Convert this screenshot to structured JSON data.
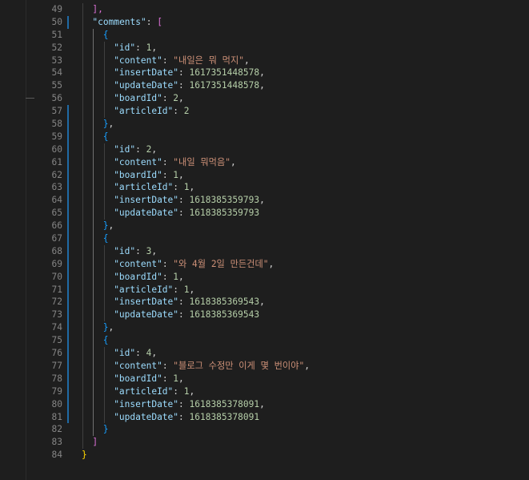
{
  "editor": {
    "lines": [
      {
        "n": "49",
        "d": 1,
        "tokens": [
          {
            "t": "],",
            "c": "b2"
          }
        ]
      },
      {
        "n": "50",
        "d": 1,
        "tokens": [
          {
            "t": "\"comments\"",
            "c": "key"
          },
          {
            "t": ": ",
            "c": "pun"
          },
          {
            "t": "[",
            "c": "b2"
          }
        ]
      },
      {
        "n": "51",
        "d": 2,
        "tokens": [
          {
            "t": "{",
            "c": "b3"
          }
        ]
      },
      {
        "n": "52",
        "d": 3,
        "tokens": [
          {
            "t": "\"id\"",
            "c": "key"
          },
          {
            "t": ": ",
            "c": "pun"
          },
          {
            "t": "1",
            "c": "num"
          },
          {
            "t": ",",
            "c": "pun"
          }
        ]
      },
      {
        "n": "53",
        "d": 3,
        "tokens": [
          {
            "t": "\"content\"",
            "c": "key"
          },
          {
            "t": ": ",
            "c": "pun"
          },
          {
            "t": "\"내일은 뭐 먹지\"",
            "c": "str"
          },
          {
            "t": ",",
            "c": "pun"
          }
        ]
      },
      {
        "n": "54",
        "d": 3,
        "tokens": [
          {
            "t": "\"insertDate\"",
            "c": "key"
          },
          {
            "t": ": ",
            "c": "pun"
          },
          {
            "t": "1617351448578",
            "c": "num"
          },
          {
            "t": ",",
            "c": "pun"
          }
        ]
      },
      {
        "n": "55",
        "d": 3,
        "tokens": [
          {
            "t": "\"updateDate\"",
            "c": "key"
          },
          {
            "t": ": ",
            "c": "pun"
          },
          {
            "t": "1617351448578",
            "c": "num"
          },
          {
            "t": ",",
            "c": "pun"
          }
        ]
      },
      {
        "n": "56",
        "d": 3,
        "tokens": [
          {
            "t": "\"boardId\"",
            "c": "key"
          },
          {
            "t": ": ",
            "c": "pun"
          },
          {
            "t": "2",
            "c": "num"
          },
          {
            "t": ",",
            "c": "pun"
          }
        ]
      },
      {
        "n": "57",
        "d": 3,
        "tokens": [
          {
            "t": "\"articleId\"",
            "c": "key"
          },
          {
            "t": ": ",
            "c": "pun"
          },
          {
            "t": "2",
            "c": "num"
          }
        ]
      },
      {
        "n": "58",
        "d": 2,
        "tokens": [
          {
            "t": "}",
            "c": "b3"
          },
          {
            "t": ",",
            "c": "pun"
          }
        ]
      },
      {
        "n": "59",
        "d": 2,
        "tokens": [
          {
            "t": "{",
            "c": "b3"
          }
        ]
      },
      {
        "n": "60",
        "d": 3,
        "tokens": [
          {
            "t": "\"id\"",
            "c": "key"
          },
          {
            "t": ": ",
            "c": "pun"
          },
          {
            "t": "2",
            "c": "num"
          },
          {
            "t": ",",
            "c": "pun"
          }
        ]
      },
      {
        "n": "61",
        "d": 3,
        "tokens": [
          {
            "t": "\"content\"",
            "c": "key"
          },
          {
            "t": ": ",
            "c": "pun"
          },
          {
            "t": "\"내일 뭐먹음\"",
            "c": "str"
          },
          {
            "t": ",",
            "c": "pun"
          }
        ]
      },
      {
        "n": "62",
        "d": 3,
        "tokens": [
          {
            "t": "\"boardId\"",
            "c": "key"
          },
          {
            "t": ": ",
            "c": "pun"
          },
          {
            "t": "1",
            "c": "num"
          },
          {
            "t": ",",
            "c": "pun"
          }
        ]
      },
      {
        "n": "63",
        "d": 3,
        "tokens": [
          {
            "t": "\"articleId\"",
            "c": "key"
          },
          {
            "t": ": ",
            "c": "pun"
          },
          {
            "t": "1",
            "c": "num"
          },
          {
            "t": ",",
            "c": "pun"
          }
        ]
      },
      {
        "n": "64",
        "d": 3,
        "tokens": [
          {
            "t": "\"insertDate\"",
            "c": "key"
          },
          {
            "t": ": ",
            "c": "pun"
          },
          {
            "t": "1618385359793",
            "c": "num"
          },
          {
            "t": ",",
            "c": "pun"
          }
        ]
      },
      {
        "n": "65",
        "d": 3,
        "tokens": [
          {
            "t": "\"updateDate\"",
            "c": "key"
          },
          {
            "t": ": ",
            "c": "pun"
          },
          {
            "t": "1618385359793",
            "c": "num"
          }
        ]
      },
      {
        "n": "66",
        "d": 2,
        "tokens": [
          {
            "t": "}",
            "c": "b3"
          },
          {
            "t": ",",
            "c": "pun"
          }
        ]
      },
      {
        "n": "67",
        "d": 2,
        "tokens": [
          {
            "t": "{",
            "c": "b3"
          }
        ]
      },
      {
        "n": "68",
        "d": 3,
        "tokens": [
          {
            "t": "\"id\"",
            "c": "key"
          },
          {
            "t": ": ",
            "c": "pun"
          },
          {
            "t": "3",
            "c": "num"
          },
          {
            "t": ",",
            "c": "pun"
          }
        ]
      },
      {
        "n": "69",
        "d": 3,
        "tokens": [
          {
            "t": "\"content\"",
            "c": "key"
          },
          {
            "t": ": ",
            "c": "pun"
          },
          {
            "t": "\"와 4월 2일 만든건데\"",
            "c": "str"
          },
          {
            "t": ",",
            "c": "pun"
          }
        ]
      },
      {
        "n": "70",
        "d": 3,
        "tokens": [
          {
            "t": "\"boardId\"",
            "c": "key"
          },
          {
            "t": ": ",
            "c": "pun"
          },
          {
            "t": "1",
            "c": "num"
          },
          {
            "t": ",",
            "c": "pun"
          }
        ]
      },
      {
        "n": "71",
        "d": 3,
        "tokens": [
          {
            "t": "\"articleId\"",
            "c": "key"
          },
          {
            "t": ": ",
            "c": "pun"
          },
          {
            "t": "1",
            "c": "num"
          },
          {
            "t": ",",
            "c": "pun"
          }
        ]
      },
      {
        "n": "72",
        "d": 3,
        "tokens": [
          {
            "t": "\"insertDate\"",
            "c": "key"
          },
          {
            "t": ": ",
            "c": "pun"
          },
          {
            "t": "1618385369543",
            "c": "num"
          },
          {
            "t": ",",
            "c": "pun"
          }
        ]
      },
      {
        "n": "73",
        "d": 3,
        "tokens": [
          {
            "t": "\"updateDate\"",
            "c": "key"
          },
          {
            "t": ": ",
            "c": "pun"
          },
          {
            "t": "1618385369543",
            "c": "num"
          }
        ]
      },
      {
        "n": "74",
        "d": 2,
        "tokens": [
          {
            "t": "}",
            "c": "b3"
          },
          {
            "t": ",",
            "c": "pun"
          }
        ]
      },
      {
        "n": "75",
        "d": 2,
        "tokens": [
          {
            "t": "{",
            "c": "b3"
          }
        ]
      },
      {
        "n": "76",
        "d": 3,
        "tokens": [
          {
            "t": "\"id\"",
            "c": "key"
          },
          {
            "t": ": ",
            "c": "pun"
          },
          {
            "t": "4",
            "c": "num"
          },
          {
            "t": ",",
            "c": "pun"
          }
        ]
      },
      {
        "n": "77",
        "d": 3,
        "tokens": [
          {
            "t": "\"content\"",
            "c": "key"
          },
          {
            "t": ": ",
            "c": "pun"
          },
          {
            "t": "\"블로그 수정만 이게 몇 번이야\"",
            "c": "str"
          },
          {
            "t": ",",
            "c": "pun"
          }
        ]
      },
      {
        "n": "78",
        "d": 3,
        "tokens": [
          {
            "t": "\"boardId\"",
            "c": "key"
          },
          {
            "t": ": ",
            "c": "pun"
          },
          {
            "t": "1",
            "c": "num"
          },
          {
            "t": ",",
            "c": "pun"
          }
        ]
      },
      {
        "n": "79",
        "d": 3,
        "tokens": [
          {
            "t": "\"articleId\"",
            "c": "key"
          },
          {
            "t": ": ",
            "c": "pun"
          },
          {
            "t": "1",
            "c": "num"
          },
          {
            "t": ",",
            "c": "pun"
          }
        ]
      },
      {
        "n": "80",
        "d": 3,
        "tokens": [
          {
            "t": "\"insertDate\"",
            "c": "key"
          },
          {
            "t": ": ",
            "c": "pun"
          },
          {
            "t": "1618385378091",
            "c": "num"
          },
          {
            "t": ",",
            "c": "pun"
          }
        ]
      },
      {
        "n": "81",
        "d": 3,
        "tokens": [
          {
            "t": "\"updateDate\"",
            "c": "key"
          },
          {
            "t": ": ",
            "c": "pun"
          },
          {
            "t": "1618385378091",
            "c": "num"
          }
        ]
      },
      {
        "n": "82",
        "d": 2,
        "tokens": [
          {
            "t": "}",
            "c": "b3"
          }
        ]
      },
      {
        "n": "83",
        "d": 1,
        "tokens": [
          {
            "t": "]",
            "c": "b2"
          }
        ]
      },
      {
        "n": "84",
        "d": 0,
        "tokens": [
          {
            "t": "}",
            "c": "b1"
          }
        ]
      }
    ],
    "modified_lines": [
      "50",
      "57",
      "58",
      "59",
      "60",
      "61",
      "62",
      "63",
      "64",
      "65",
      "66",
      "67",
      "68",
      "69",
      "70",
      "71",
      "72",
      "73",
      "74",
      "75",
      "76",
      "77",
      "78",
      "79",
      "80",
      "81"
    ]
  },
  "colors": {
    "background": "#1e1e1e",
    "line_number": "#858585",
    "key": "#9cdcfe",
    "string": "#ce9178",
    "number": "#b5cea8",
    "punctuation": "#d4d4d4",
    "bracket_level_1": "#ffd700",
    "bracket_level_2": "#da70d6",
    "bracket_level_3": "#179fff",
    "modified_gutter": "#1f6aa5"
  }
}
